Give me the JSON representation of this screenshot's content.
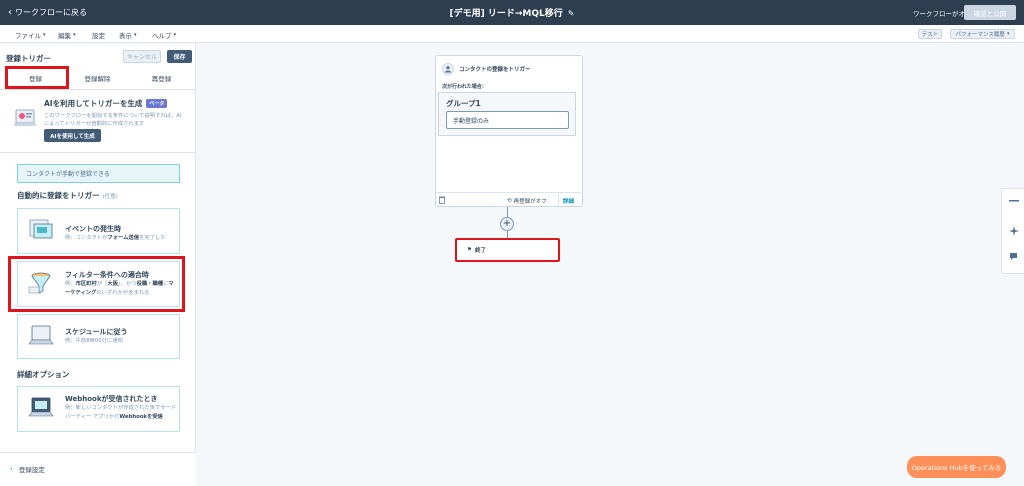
{
  "header": {
    "back_label": "ワークフローに戻る",
    "title": "[デモ用] リード→MQL移行",
    "status": "ワークフローがオフ",
    "review_label": "確認と公開"
  },
  "menu": {
    "items": [
      {
        "label": "ファイル",
        "has_caret": true
      },
      {
        "label": "編集",
        "has_caret": true
      },
      {
        "label": "設定",
        "has_caret": false
      },
      {
        "label": "表示",
        "has_caret": true
      },
      {
        "label": "ヘルプ",
        "has_caret": true
      }
    ],
    "test_label": "テスト",
    "performance_label": "パフォーマンス履歴"
  },
  "panel": {
    "title": "登録トリガー",
    "cancel_label": "キャンセル",
    "save_label": "保存",
    "tabs": [
      "登録",
      "登録解除",
      "再登録"
    ],
    "active_tab": 0,
    "ai": {
      "title": "AIを利用してトリガーを生成",
      "badge": "ベータ",
      "desc": "このワークフローを開始する条件について説明すれば、AIによってトリガーが自動的に作成されます",
      "button": "AIを使用して生成"
    },
    "manual_notice": "コンタクトが手動で登録できる",
    "auto_section": {
      "title": "自動的に登録をトリガー",
      "sub": "(任意)"
    },
    "event_card": {
      "title": "イベントの発生時",
      "desc_pre": "例：コンタクトが",
      "desc_bold": "フォーム送信",
      "desc_post": "を完了した"
    },
    "filter_card": {
      "title": "フィルター条件への適合時",
      "desc_1": "例：",
      "desc_b1": "市区町村",
      "desc_2": "が「",
      "desc_b2": "大阪",
      "desc_3": "」、かつ",
      "desc_b3": "役職・職種",
      "desc_4": "に",
      "desc_b4": "マーケティング",
      "desc_5": "のいずれかが含まれる"
    },
    "schedule_card": {
      "title": "スケジュールに従う",
      "desc": "例：午前8時00分に通知"
    },
    "advanced_section": {
      "title": "詳細オプション"
    },
    "webhook_card": {
      "title": "Webhookが受信されたとき",
      "desc_pre": "例：新しいコンタクトが作成された後でサードパーティー アプリから",
      "desc_bold": "Webhookを受信"
    },
    "footer_label": "登録設定"
  },
  "canvas": {
    "trigger": {
      "header": "コンタクトの登録をトリガー",
      "when_label": "次が行われた場合：",
      "group_title": "グループ1",
      "condition": "手動登録のみ",
      "reenroll": "再登録がオフ",
      "details": "詳細"
    },
    "end_label": "終了"
  },
  "ops_button": "Operations Hubを使ってみる"
}
